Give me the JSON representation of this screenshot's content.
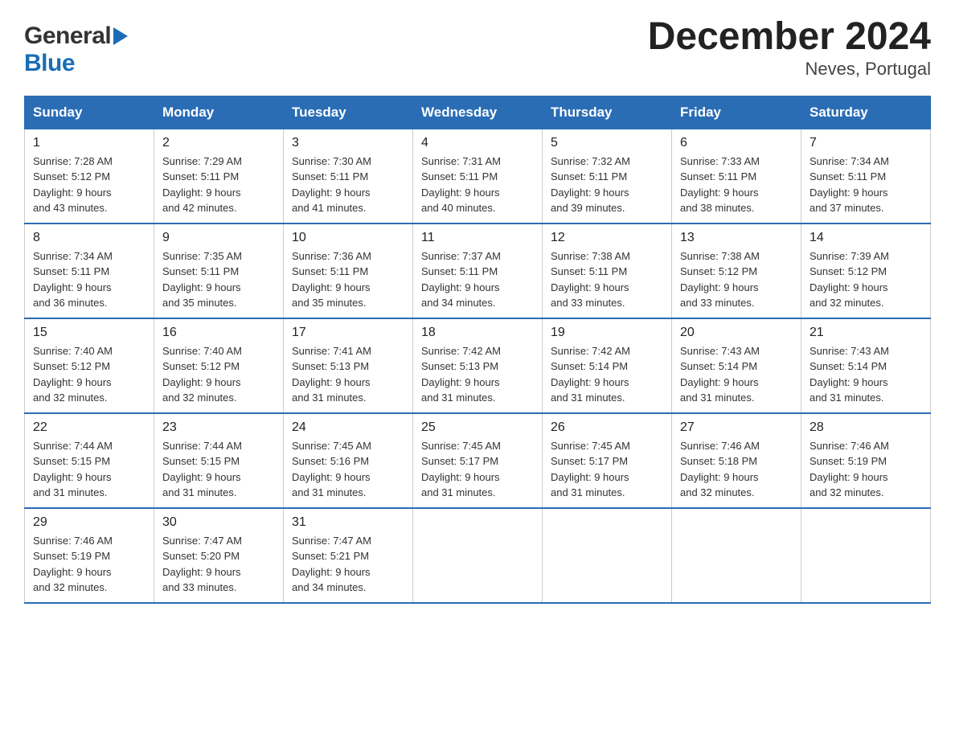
{
  "header": {
    "month_title": "December 2024",
    "location": "Neves, Portugal"
  },
  "days_of_week": [
    "Sunday",
    "Monday",
    "Tuesday",
    "Wednesday",
    "Thursday",
    "Friday",
    "Saturday"
  ],
  "weeks": [
    [
      {
        "day": "1",
        "sunrise": "7:28 AM",
        "sunset": "5:12 PM",
        "daylight": "9 hours and 43 minutes."
      },
      {
        "day": "2",
        "sunrise": "7:29 AM",
        "sunset": "5:11 PM",
        "daylight": "9 hours and 42 minutes."
      },
      {
        "day": "3",
        "sunrise": "7:30 AM",
        "sunset": "5:11 PM",
        "daylight": "9 hours and 41 minutes."
      },
      {
        "day": "4",
        "sunrise": "7:31 AM",
        "sunset": "5:11 PM",
        "daylight": "9 hours and 40 minutes."
      },
      {
        "day": "5",
        "sunrise": "7:32 AM",
        "sunset": "5:11 PM",
        "daylight": "9 hours and 39 minutes."
      },
      {
        "day": "6",
        "sunrise": "7:33 AM",
        "sunset": "5:11 PM",
        "daylight": "9 hours and 38 minutes."
      },
      {
        "day": "7",
        "sunrise": "7:34 AM",
        "sunset": "5:11 PM",
        "daylight": "9 hours and 37 minutes."
      }
    ],
    [
      {
        "day": "8",
        "sunrise": "7:34 AM",
        "sunset": "5:11 PM",
        "daylight": "9 hours and 36 minutes."
      },
      {
        "day": "9",
        "sunrise": "7:35 AM",
        "sunset": "5:11 PM",
        "daylight": "9 hours and 35 minutes."
      },
      {
        "day": "10",
        "sunrise": "7:36 AM",
        "sunset": "5:11 PM",
        "daylight": "9 hours and 35 minutes."
      },
      {
        "day": "11",
        "sunrise": "7:37 AM",
        "sunset": "5:11 PM",
        "daylight": "9 hours and 34 minutes."
      },
      {
        "day": "12",
        "sunrise": "7:38 AM",
        "sunset": "5:11 PM",
        "daylight": "9 hours and 33 minutes."
      },
      {
        "day": "13",
        "sunrise": "7:38 AM",
        "sunset": "5:12 PM",
        "daylight": "9 hours and 33 minutes."
      },
      {
        "day": "14",
        "sunrise": "7:39 AM",
        "sunset": "5:12 PM",
        "daylight": "9 hours and 32 minutes."
      }
    ],
    [
      {
        "day": "15",
        "sunrise": "7:40 AM",
        "sunset": "5:12 PM",
        "daylight": "9 hours and 32 minutes."
      },
      {
        "day": "16",
        "sunrise": "7:40 AM",
        "sunset": "5:12 PM",
        "daylight": "9 hours and 32 minutes."
      },
      {
        "day": "17",
        "sunrise": "7:41 AM",
        "sunset": "5:13 PM",
        "daylight": "9 hours and 31 minutes."
      },
      {
        "day": "18",
        "sunrise": "7:42 AM",
        "sunset": "5:13 PM",
        "daylight": "9 hours and 31 minutes."
      },
      {
        "day": "19",
        "sunrise": "7:42 AM",
        "sunset": "5:14 PM",
        "daylight": "9 hours and 31 minutes."
      },
      {
        "day": "20",
        "sunrise": "7:43 AM",
        "sunset": "5:14 PM",
        "daylight": "9 hours and 31 minutes."
      },
      {
        "day": "21",
        "sunrise": "7:43 AM",
        "sunset": "5:14 PM",
        "daylight": "9 hours and 31 minutes."
      }
    ],
    [
      {
        "day": "22",
        "sunrise": "7:44 AM",
        "sunset": "5:15 PM",
        "daylight": "9 hours and 31 minutes."
      },
      {
        "day": "23",
        "sunrise": "7:44 AM",
        "sunset": "5:15 PM",
        "daylight": "9 hours and 31 minutes."
      },
      {
        "day": "24",
        "sunrise": "7:45 AM",
        "sunset": "5:16 PM",
        "daylight": "9 hours and 31 minutes."
      },
      {
        "day": "25",
        "sunrise": "7:45 AM",
        "sunset": "5:17 PM",
        "daylight": "9 hours and 31 minutes."
      },
      {
        "day": "26",
        "sunrise": "7:45 AM",
        "sunset": "5:17 PM",
        "daylight": "9 hours and 31 minutes."
      },
      {
        "day": "27",
        "sunrise": "7:46 AM",
        "sunset": "5:18 PM",
        "daylight": "9 hours and 32 minutes."
      },
      {
        "day": "28",
        "sunrise": "7:46 AM",
        "sunset": "5:19 PM",
        "daylight": "9 hours and 32 minutes."
      }
    ],
    [
      {
        "day": "29",
        "sunrise": "7:46 AM",
        "sunset": "5:19 PM",
        "daylight": "9 hours and 32 minutes."
      },
      {
        "day": "30",
        "sunrise": "7:47 AM",
        "sunset": "5:20 PM",
        "daylight": "9 hours and 33 minutes."
      },
      {
        "day": "31",
        "sunrise": "7:47 AM",
        "sunset": "5:21 PM",
        "daylight": "9 hours and 34 minutes."
      },
      null,
      null,
      null,
      null
    ]
  ],
  "labels": {
    "sunrise_prefix": "Sunrise: ",
    "sunset_prefix": "Sunset: ",
    "daylight_prefix": "Daylight: "
  },
  "logo": {
    "general": "General",
    "blue": "Blue"
  }
}
